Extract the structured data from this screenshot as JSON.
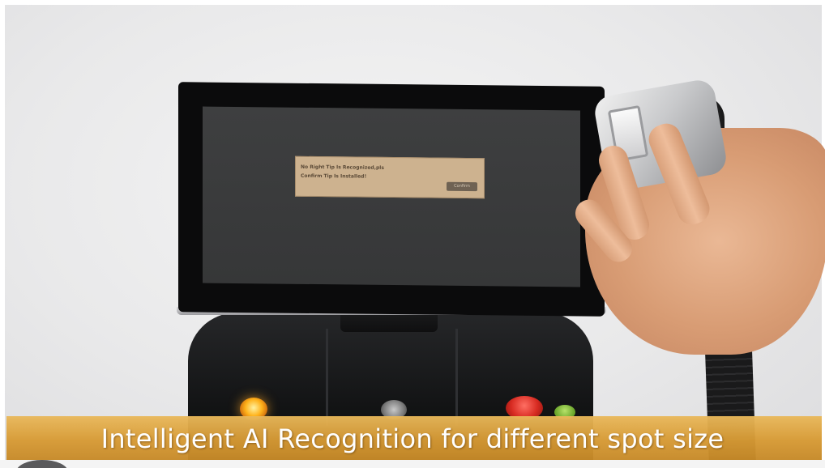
{
  "screen_dialog": {
    "message": "No Right Tip Is Recognized,pls\nConfirm Tip Is Installed!",
    "button_label": "Confirm"
  },
  "caption": {
    "text": "Intelligent AI Recognition for different spot size"
  },
  "colors": {
    "caption_band": "#d99d38",
    "dialog_background": "#cdb28f",
    "screen": "#3a3b3c"
  }
}
